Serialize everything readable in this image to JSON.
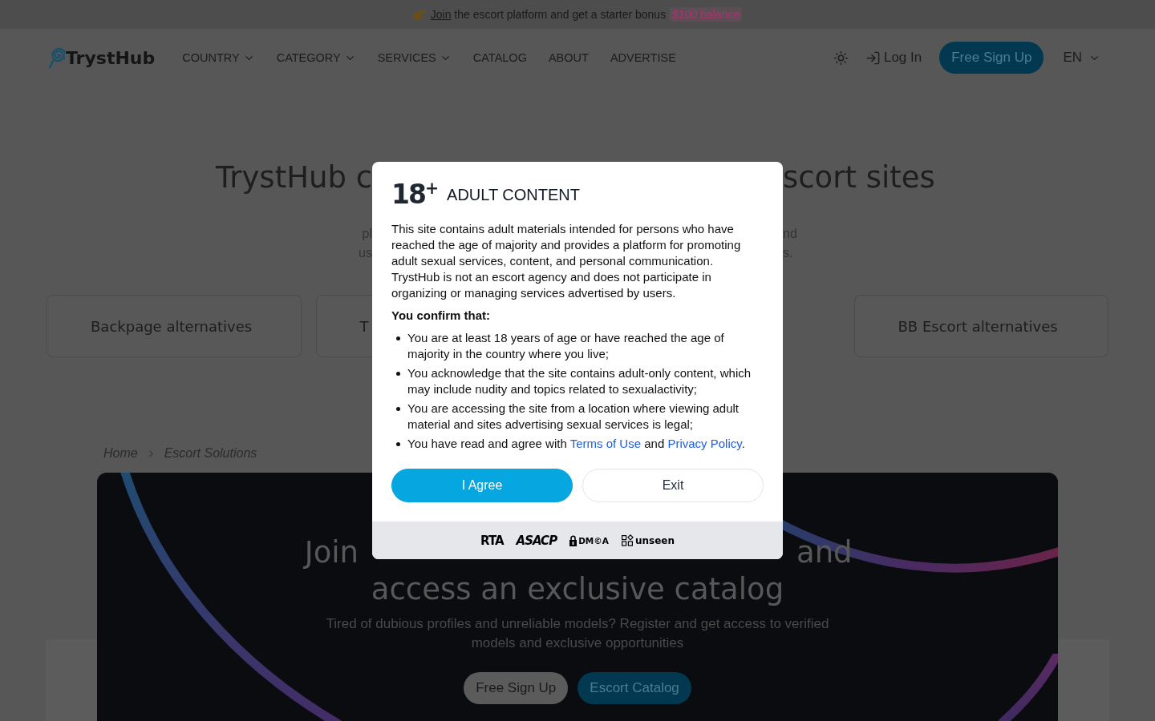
{
  "announcement": {
    "link": "Join",
    "text": "the escort platform and get a starter bonus",
    "bonus": "$100 balance"
  },
  "nav": {
    "logo": "TrystHub",
    "items": [
      {
        "label": "COUNTRY",
        "dropdown": true
      },
      {
        "label": "CATEGORY",
        "dropdown": true
      },
      {
        "label": "SERVICES",
        "dropdown": true
      },
      {
        "label": "CATALOG",
        "dropdown": false
      },
      {
        "label": "ABOUT",
        "dropdown": false
      },
      {
        "label": "ADVERTISE",
        "dropdown": false
      }
    ],
    "login": "Log In",
    "signup": "Free Sign Up",
    "language": "EN"
  },
  "intro": {
    "title": {
      "left": "TrystHub c",
      "right": "scort sites"
    },
    "text_lines": [
      {
        "left": "pl",
        "right": "nd"
      },
      {
        "left": "us",
        "right": "s."
      }
    ],
    "cards": [
      {
        "label": "Backpage alternatives"
      },
      {
        "label": "T"
      },
      {
        "label": "BB Escort alternatives"
      }
    ]
  },
  "breadcrumb": [
    "Home",
    "Escort Solutions"
  ],
  "promo": {
    "title_line_1": {
      "left": "Join",
      "right": "and"
    },
    "title_line_2": "access an exclusive catalog",
    "text": "Tired of dubious profiles and unreliable models? Register and get access to verified models and exclusive opportunities",
    "buttons": [
      {
        "label": "Free Sign Up",
        "kind": "secondary"
      },
      {
        "label": "Escort Catalog",
        "kind": "primary"
      }
    ]
  },
  "dialog": {
    "badge": "18$^{+}$",
    "title": "ADULT CONTENT",
    "intro": "This site contains adult materials intended for persons who have reached the age of majority and provides a platform for promoting adult sexual services, content, and personal communication. TrystHub is not an escort agency and does not participate in organizing or managing services advertised by users.",
    "confirm_heading": "You confirm that:",
    "items": [
      [
        {
          "kind": "text",
          "text": "You are at least 18 years of age or have reached the age of majority in the country where you live;"
        }
      ],
      [
        {
          "kind": "text",
          "text": "You acknowledge that the site contains adult-only content, which may include nudity and topics related to sexualactivity;"
        }
      ],
      [
        {
          "kind": "text",
          "text": "You are accessing the site from a location where viewing adult material and sites advertising sexual services is legal;"
        }
      ],
      [
        {
          "kind": "text",
          "text": "You have read and agree with "
        },
        {
          "kind": "link",
          "text": "Terms of Use"
        },
        {
          "kind": "text",
          "text": " and "
        },
        {
          "kind": "link",
          "text": "Privacy Policy"
        },
        {
          "kind": "text",
          "text": "."
        }
      ]
    ],
    "buttons": [
      {
        "label": "I Agree",
        "kind": "confirm"
      },
      {
        "label": "Exit",
        "kind": "cancel"
      }
    ],
    "partners": [
      {
        "kind": "rta",
        "label": "RTA"
      },
      {
        "kind": "asacp",
        "label": "ASACP"
      },
      {
        "kind": "dmca",
        "label": "DM©A"
      },
      {
        "kind": "unseen",
        "label": "unseen"
      }
    ]
  }
}
